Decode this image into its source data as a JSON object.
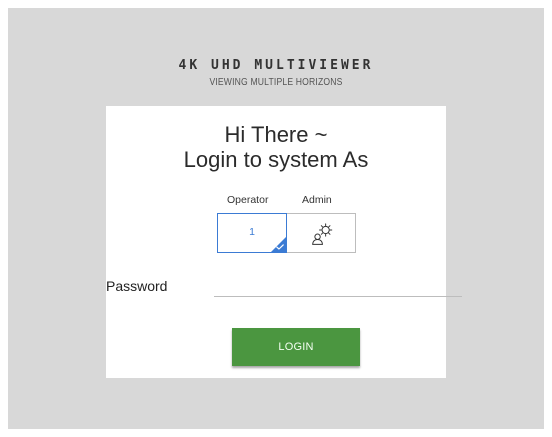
{
  "brand": {
    "title": "4K UHD MULTIVIEWER",
    "subtitle": "VIEWING MULTIPLE HORIZONS"
  },
  "login_panel": {
    "greeting_line_1": "Hi There ~",
    "greeting_line_2": "Login to system As",
    "roles": [
      {
        "label": "Operator",
        "value": "1",
        "selected": true
      },
      {
        "label": "Admin",
        "icon": "admin-settings-icon",
        "selected": false
      }
    ],
    "password_label": "Password",
    "password_value": "",
    "login_button_label": "LOGIN"
  },
  "colors": {
    "background": "#d8d8d8",
    "card": "#ffffff",
    "selected_accent": "#3b7bd4",
    "button": "#4b9640"
  }
}
